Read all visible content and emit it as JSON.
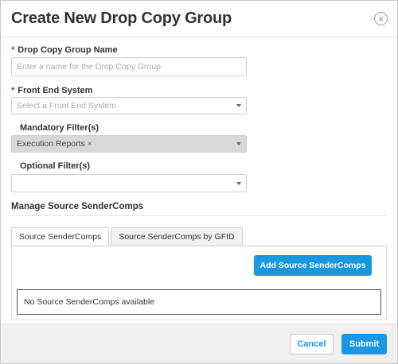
{
  "dialog": {
    "title": "Create New Drop Copy Group",
    "close_icon": "close-circle-icon"
  },
  "form": {
    "group_name": {
      "required_mark": "*",
      "label": "Drop Copy Group Name",
      "placeholder": "Enter a name for the Drop Copy Group",
      "value": ""
    },
    "front_end_system": {
      "required_mark": "*",
      "label": "Front End System",
      "placeholder": "Select a Front End System",
      "value": ""
    },
    "mandatory_filters": {
      "label": "Mandatory Filter(s)",
      "selected": [
        "Execution Reports"
      ],
      "remove_glyph": "×",
      "disabled": true
    },
    "optional_filters": {
      "label": "Optional Filter(s)",
      "value": ""
    }
  },
  "source_sendercomps": {
    "section_title": "Manage Source SenderComps",
    "tabs": [
      {
        "label": "Source SenderComps",
        "active": true
      },
      {
        "label": "Source SenderComps by GFID",
        "active": false
      }
    ],
    "add_button_label": "Add Source SenderComps",
    "empty_message": "No Source SenderComps available"
  },
  "footer": {
    "cancel_label": "Cancel",
    "submit_label": "Submit"
  },
  "colors": {
    "accent": "#1898e0",
    "required": "#d9282e",
    "disabled_bg": "#d9d9d9"
  }
}
